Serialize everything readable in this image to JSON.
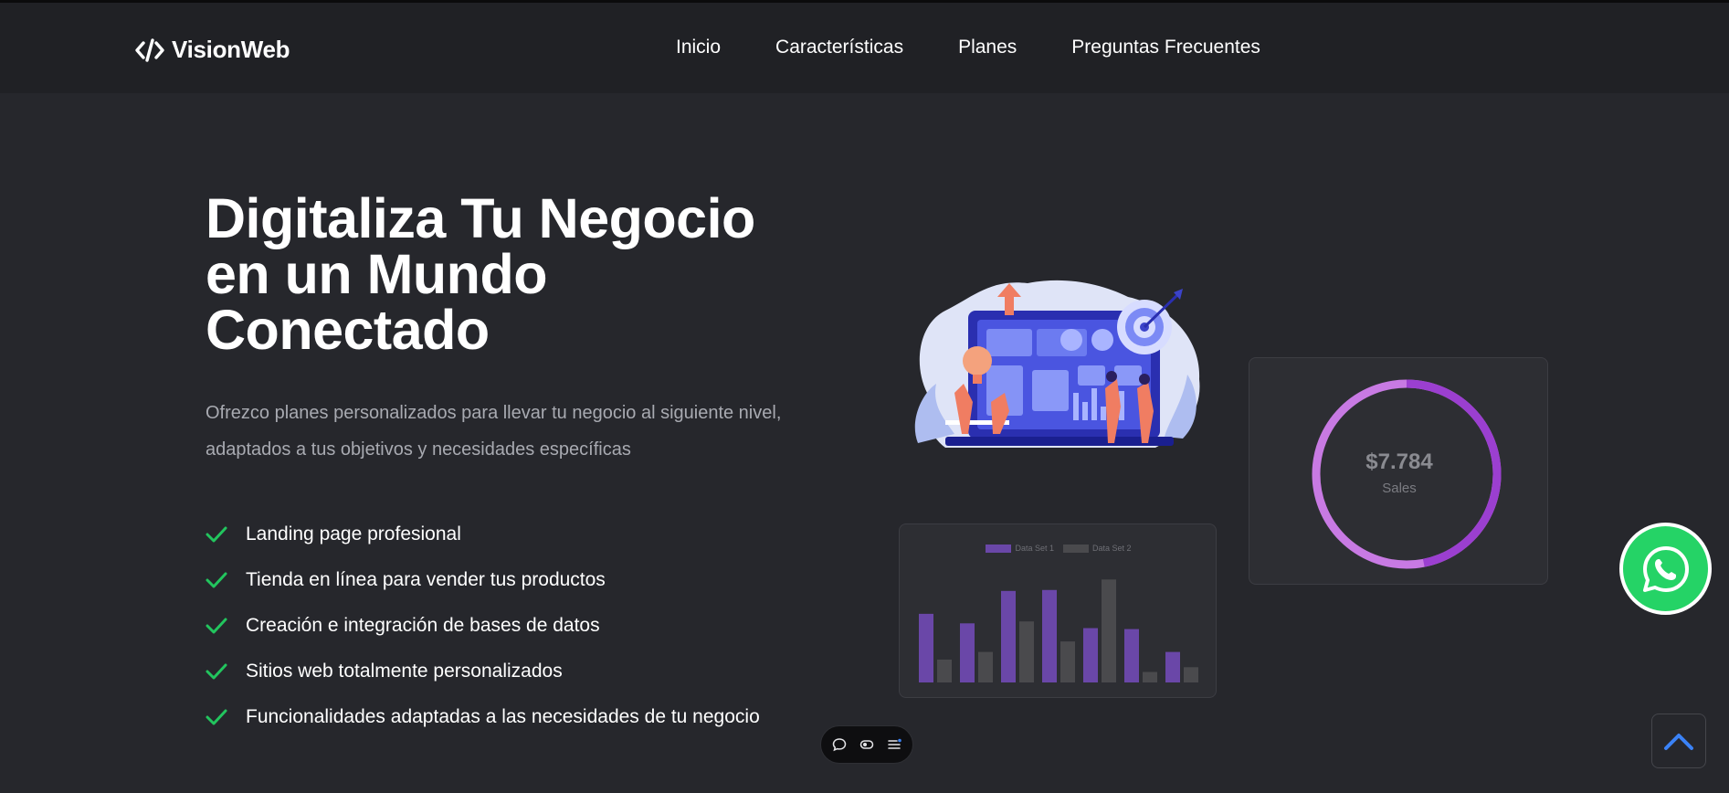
{
  "brand": {
    "name": "VisionWeb",
    "logo_icon": "code-brackets-icon"
  },
  "nav": {
    "links": [
      "Inicio",
      "Características",
      "Planes",
      "Preguntas Frecuentes"
    ]
  },
  "hero": {
    "title_lines": [
      "Digitaliza Tu Negocio",
      "en un Mundo",
      "Conectado"
    ],
    "subtitle": "Ofrezco planes personalizados para llevar tu negocio al siguiente nivel, adaptados a tus objetivos y necesidades específicas",
    "features": [
      "Landing page profesional",
      "Tienda en línea para vender tus productos",
      "Creación e integración de bases de datos",
      "Sitios web totalmente personalizados",
      "Funcionalidades adaptadas a las necesidades de tu negocio"
    ],
    "check_icon": "checkmark-icon"
  },
  "sales_card": {
    "value": "$7.784",
    "label": "Sales",
    "colors": [
      "#9b3fd0",
      "#c87ae3"
    ]
  },
  "chart_data": {
    "type": "bar",
    "categories": [
      "",
      "",
      "",
      "",
      "",
      "",
      ""
    ],
    "series": [
      {
        "name": "Data Set 1",
        "color": "#6a47a8",
        "values": [
          72,
          62,
          96,
          97,
          57,
          56,
          32
        ]
      },
      {
        "name": "Data Set 2",
        "color": "#4a4a4d",
        "values": [
          24,
          32,
          64,
          43,
          108,
          11,
          16
        ]
      }
    ],
    "ylim": [
      0,
      115
    ],
    "legend_position": "top",
    "grid": false
  },
  "colors": {
    "accent_check": "#22c55e",
    "whatsapp": "#25d366",
    "scroll_arrow": "#3b82f6"
  },
  "widgets": {
    "whatsapp_icon": "whatsapp-icon",
    "scroll_top_icon": "chevron-up-icon",
    "toolbar_icons": [
      "comment-icon",
      "toggle-icon",
      "menu-icon"
    ]
  }
}
